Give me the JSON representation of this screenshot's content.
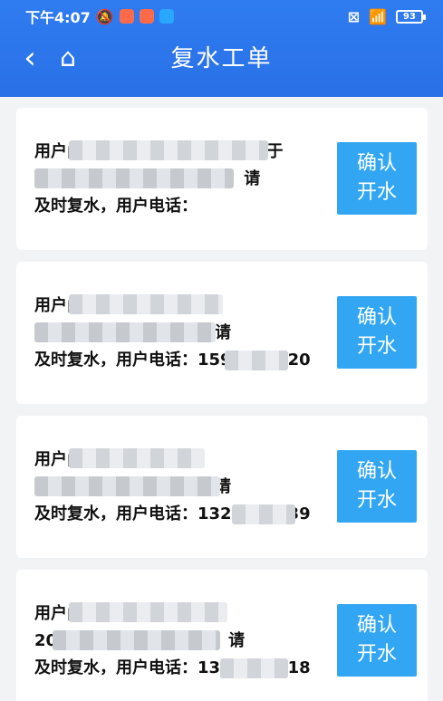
{
  "status_bar": {
    "time": "下午4:07",
    "battery": "93"
  },
  "header": {
    "title": "复水工单"
  },
  "items": [
    {
      "message": "用户▯▯▯▯▯▯▯▯▯▯▯▯▯▯256)，已于\n▯▯▯▯▯▯▯▯▯▯▯▯▯7恢复用水，请\n及时复水，用户电话：",
      "button": "确认\n开水"
    },
    {
      "message": "用户▯▯▯▯▯▯▯▯▯，已于\n▯▯▯▯▯▯▯▯▯▯▯恢复用水，请\n及时复水，用户电话：159▯▯▯▯▯420",
      "button": "确认\n开水"
    },
    {
      "message": "用户▯▯▯▯▯▯▯▯▯)，已于\n▯▯▯▯▯▯▯▯▯▯▯恢复用水，请\n及时复水，用户电话：132▯▯▯▯▯139",
      "button": "确认\n开水"
    },
    {
      "message": "用户▯▯▯▯▯▯▯▯▯，已于\n20▯▯▯▯▯▯▯▯▯▯恢复用水，请\n及时复水，用户电话：13▯▯▯▯▯7718",
      "button": "确认\n开水"
    }
  ]
}
